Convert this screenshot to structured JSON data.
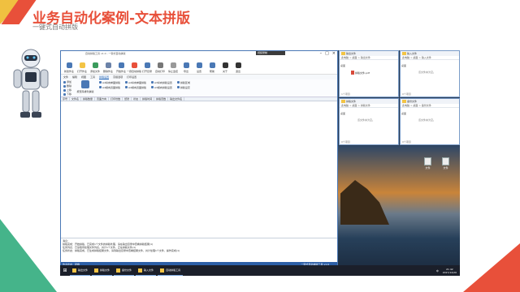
{
  "slide": {
    "title": "业务自动化案例-文本拼版",
    "subtitle": "一键式自动拼版"
  },
  "app": {
    "window_title": "自动拼版工具 v1.0 - 一键式自动拼版",
    "size_indicator": "视频录制",
    "toolbar": [
      {
        "label": "新建作业",
        "color": "#4a78b5"
      },
      {
        "label": "打开作业",
        "color": "#f3c445"
      },
      {
        "label": "添加文件",
        "color": "#3a9b5c"
      },
      {
        "label": "删除作业",
        "color": "#6b82a8"
      },
      {
        "label": "开始作业",
        "color": "#4a78b5"
      },
      {
        "label": "一键自动拼版",
        "color": "#e8503a"
      },
      {
        "label": "打开目录",
        "color": "#4a78b5"
      },
      {
        "label": "自动打印",
        "color": "#777777"
      },
      {
        "label": "停止监控",
        "color": "#999999"
      },
      {
        "label": "导出",
        "color": "#4a78b5"
      },
      {
        "label": "设置",
        "color": "#4a78b5"
      },
      {
        "label": "帮助",
        "color": "#4a78b5"
      },
      {
        "label": "关于",
        "color": "#333333"
      },
      {
        "label": "退出",
        "color": "#333333"
      }
    ],
    "menu": [
      "文件",
      "编辑",
      "视图",
      "工具",
      "拼版设置",
      "高级选项",
      "打印设置"
    ],
    "menu_active_index": 4,
    "ribbon_col1": [
      "添加",
      "删除",
      "上移",
      "下移"
    ],
    "ribbon_big_label": "按页码排列拼版",
    "ribbon_cols": [
      [
        "A4纵向单面拼版",
        "A4横向双面拼版"
      ],
      [
        "A4纵向单面拼版",
        "A4横向双面拼版"
      ],
      [
        "A3纵向拼版设置",
        "A3横向拼版设置"
      ],
      [
        "拼版区域",
        "拼版设定"
      ]
    ],
    "grid_columns": [
      "序号",
      "文件名",
      "拼版数量",
      "页面方向",
      "打印份数",
      "纸张",
      "状态",
      "拼版时间",
      "拼版页数",
      "输出文件名"
    ],
    "log_lines": [
      "消息：",
      "拼版完成：开始拼版，已完成1个文件的拼版处理，请在输出目录中查看拼版结果(1)",
      "任务列表：已读取待处理文件列表，共计1个文件，正在拼版文件(1)",
      "任务状态：拼版完成，已生成拼版结果文件，请到输出目录中查看结果文件，共计处理1个文件，操作完成(1)"
    ],
    "statusbar_left": "作业状态：就绪",
    "statusbar_right": "一键式自动拼版工具 v1.0"
  },
  "explorers": [
    {
      "title": "输出文件",
      "path": "此电脑 > 桌面 > 输出文件",
      "side": "桌面",
      "file": "拼版文件.pdf",
      "empty": "",
      "status": "1个项目"
    },
    {
      "title": "输入文件",
      "path": "此电脑 > 桌面 > 输入文件",
      "side": "桌面",
      "file": "",
      "empty": "该文件夹为空。",
      "status": "0个项目"
    },
    {
      "title": "拼版文件",
      "path": "此电脑 > 桌面 > 拼版文件",
      "side": "桌面",
      "file": "",
      "empty": "该文件夹为空。",
      "status": "0个项目"
    },
    {
      "title": "备份文件",
      "path": "此电脑 > 桌面 > 备份文件",
      "side": "桌面",
      "file": "",
      "empty": "该文件夹为空。",
      "status": "0个项目"
    }
  ],
  "desktop_icons": [
    {
      "label": "文件"
    },
    {
      "label": "文件"
    }
  ],
  "taskbar": {
    "items": [
      {
        "label": "输出文件"
      },
      {
        "label": "拼版文件"
      },
      {
        "label": "备份文件"
      },
      {
        "label": "输入文件"
      },
      {
        "label": "自动拼版工具"
      }
    ],
    "tray": "中",
    "time": "21:42",
    "date": "2017/12/20"
  }
}
